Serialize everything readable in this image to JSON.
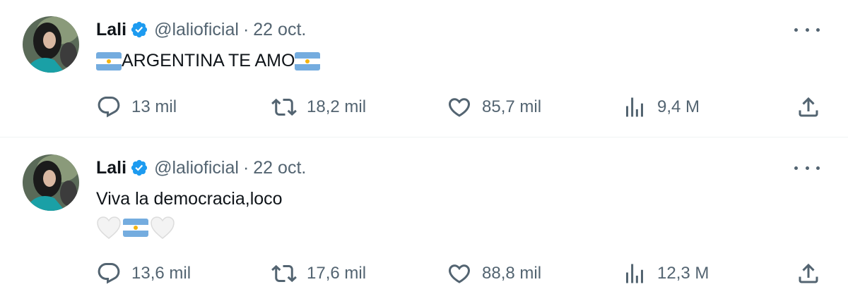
{
  "tweets": [
    {
      "author_name": "Lali",
      "handle": "@lalioficial",
      "separator": "·",
      "date": "22 oct.",
      "text": "ARGENTINA TE AMO",
      "stats": {
        "replies": "13 mil",
        "retweets": "18,2 mil",
        "likes": "85,7 mil",
        "views": "9,4 M"
      }
    },
    {
      "author_name": "Lali",
      "handle": "@lalioficial",
      "separator": "·",
      "date": "22 oct.",
      "text": "Viva la democracia,loco",
      "stats": {
        "replies": "13,6 mil",
        "retweets": "17,6 mil",
        "likes": "88,8 mil",
        "views": "12,3 M"
      }
    }
  ],
  "icons": {
    "verified": "verified-badge-icon",
    "more": "more-options-icon",
    "reply": "reply-icon",
    "retweet": "retweet-icon",
    "like": "heart-icon",
    "views": "views-chart-icon",
    "share": "share-icon",
    "flag": "argentina-flag-emoji",
    "white_heart": "white-heart-emoji"
  },
  "colors": {
    "verified": "#1d9bf0",
    "text": "#0f1419",
    "secondary": "#536471",
    "divider": "#eff3f4"
  }
}
